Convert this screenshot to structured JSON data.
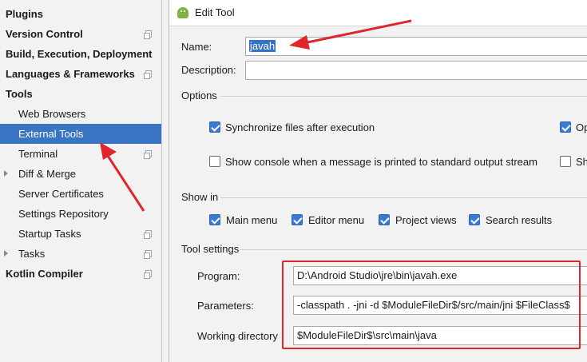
{
  "sidebar": {
    "items": [
      {
        "label": "Plugins",
        "level": "top",
        "selected": false,
        "has_icon": false,
        "has_arrow": false
      },
      {
        "label": "Version Control",
        "level": "top",
        "selected": false,
        "has_icon": true,
        "has_arrow": false
      },
      {
        "label": "Build, Execution, Deployment",
        "level": "top",
        "selected": false,
        "has_icon": false,
        "has_arrow": false
      },
      {
        "label": "Languages & Frameworks",
        "level": "top",
        "selected": false,
        "has_icon": true,
        "has_arrow": false
      },
      {
        "label": "Tools",
        "level": "top",
        "selected": false,
        "has_icon": false,
        "has_arrow": false
      },
      {
        "label": "Web Browsers",
        "level": "sub",
        "selected": false,
        "has_icon": false,
        "has_arrow": false
      },
      {
        "label": "External Tools",
        "level": "sub",
        "selected": true,
        "has_icon": false,
        "has_arrow": false
      },
      {
        "label": "Terminal",
        "level": "sub",
        "selected": false,
        "has_icon": true,
        "has_arrow": false
      },
      {
        "label": "Diff & Merge",
        "level": "sub",
        "selected": false,
        "has_icon": false,
        "has_arrow": true
      },
      {
        "label": "Server Certificates",
        "level": "sub",
        "selected": false,
        "has_icon": false,
        "has_arrow": false
      },
      {
        "label": "Settings Repository",
        "level": "sub",
        "selected": false,
        "has_icon": false,
        "has_arrow": false
      },
      {
        "label": "Startup Tasks",
        "level": "sub",
        "selected": false,
        "has_icon": true,
        "has_arrow": false
      },
      {
        "label": "Tasks",
        "level": "sub",
        "selected": false,
        "has_icon": true,
        "has_arrow": true
      },
      {
        "label": "Kotlin Compiler",
        "level": "top",
        "selected": false,
        "has_icon": true,
        "has_arrow": false
      }
    ]
  },
  "dialog": {
    "title": "Edit Tool",
    "name_label": "Name:",
    "name_value": "javah",
    "description_label": "Description:",
    "description_value": "",
    "options_title": "Options",
    "options": {
      "sync_label": "Synchronize files after execution",
      "sync_checked": true,
      "op_label": "Op",
      "op_checked": true,
      "console_label": "Show console when a message is printed to standard output stream",
      "console_checked": false,
      "sh_label": "Sh",
      "sh_checked": false
    },
    "show_in_title": "Show in",
    "show_in": [
      {
        "label": "Main menu",
        "checked": true
      },
      {
        "label": "Editor menu",
        "checked": true
      },
      {
        "label": "Project views",
        "checked": true
      },
      {
        "label": "Search results",
        "checked": true
      }
    ],
    "tool_settings_title": "Tool settings",
    "program_label": "Program:",
    "program_value": "D:\\Android Studio\\jre\\bin\\javah.exe",
    "parameters_label": "Parameters:",
    "parameters_value": "-classpath . -jni -d $ModuleFileDir$/src/main/jni $FileClass$",
    "working_dir_label": "Working directory",
    "working_dir_value": "$ModuleFileDir$\\src\\main\\java"
  },
  "colors": {
    "selection": "#3a75c4",
    "checkbox": "#3a7ad4",
    "annotation_red": "#e0262b"
  }
}
